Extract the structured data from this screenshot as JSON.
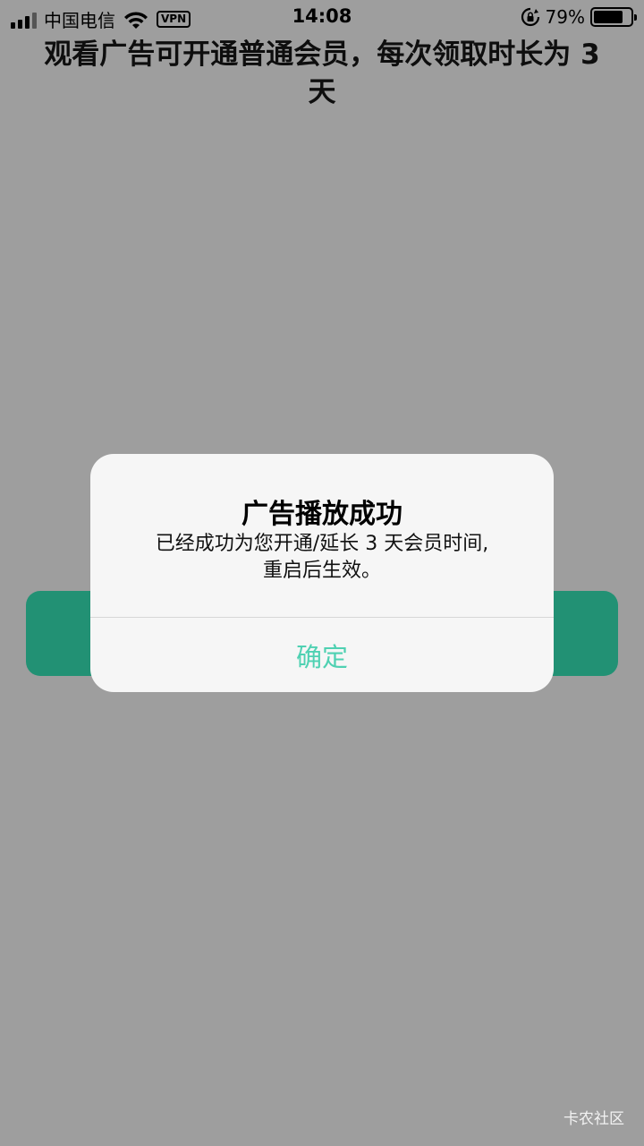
{
  "status_bar": {
    "carrier": "中国电信",
    "vpn_label": "VPN",
    "time": "14:08",
    "battery_percent_label": "79%",
    "battery_level": 0.79
  },
  "page": {
    "title": "观看广告可开通普通会员，每次领取时长为 3 天"
  },
  "dialog": {
    "title": "广告播放成功",
    "message_line1": "已经成功为您开通/延长 3 天会员时间,",
    "message_line2": "重启后生效。",
    "confirm_label": "确定"
  },
  "watermark": "卡农社区",
  "colors": {
    "background": "#9e9e9e",
    "button_green": "#229174",
    "confirm_text": "#4fd1b2"
  }
}
